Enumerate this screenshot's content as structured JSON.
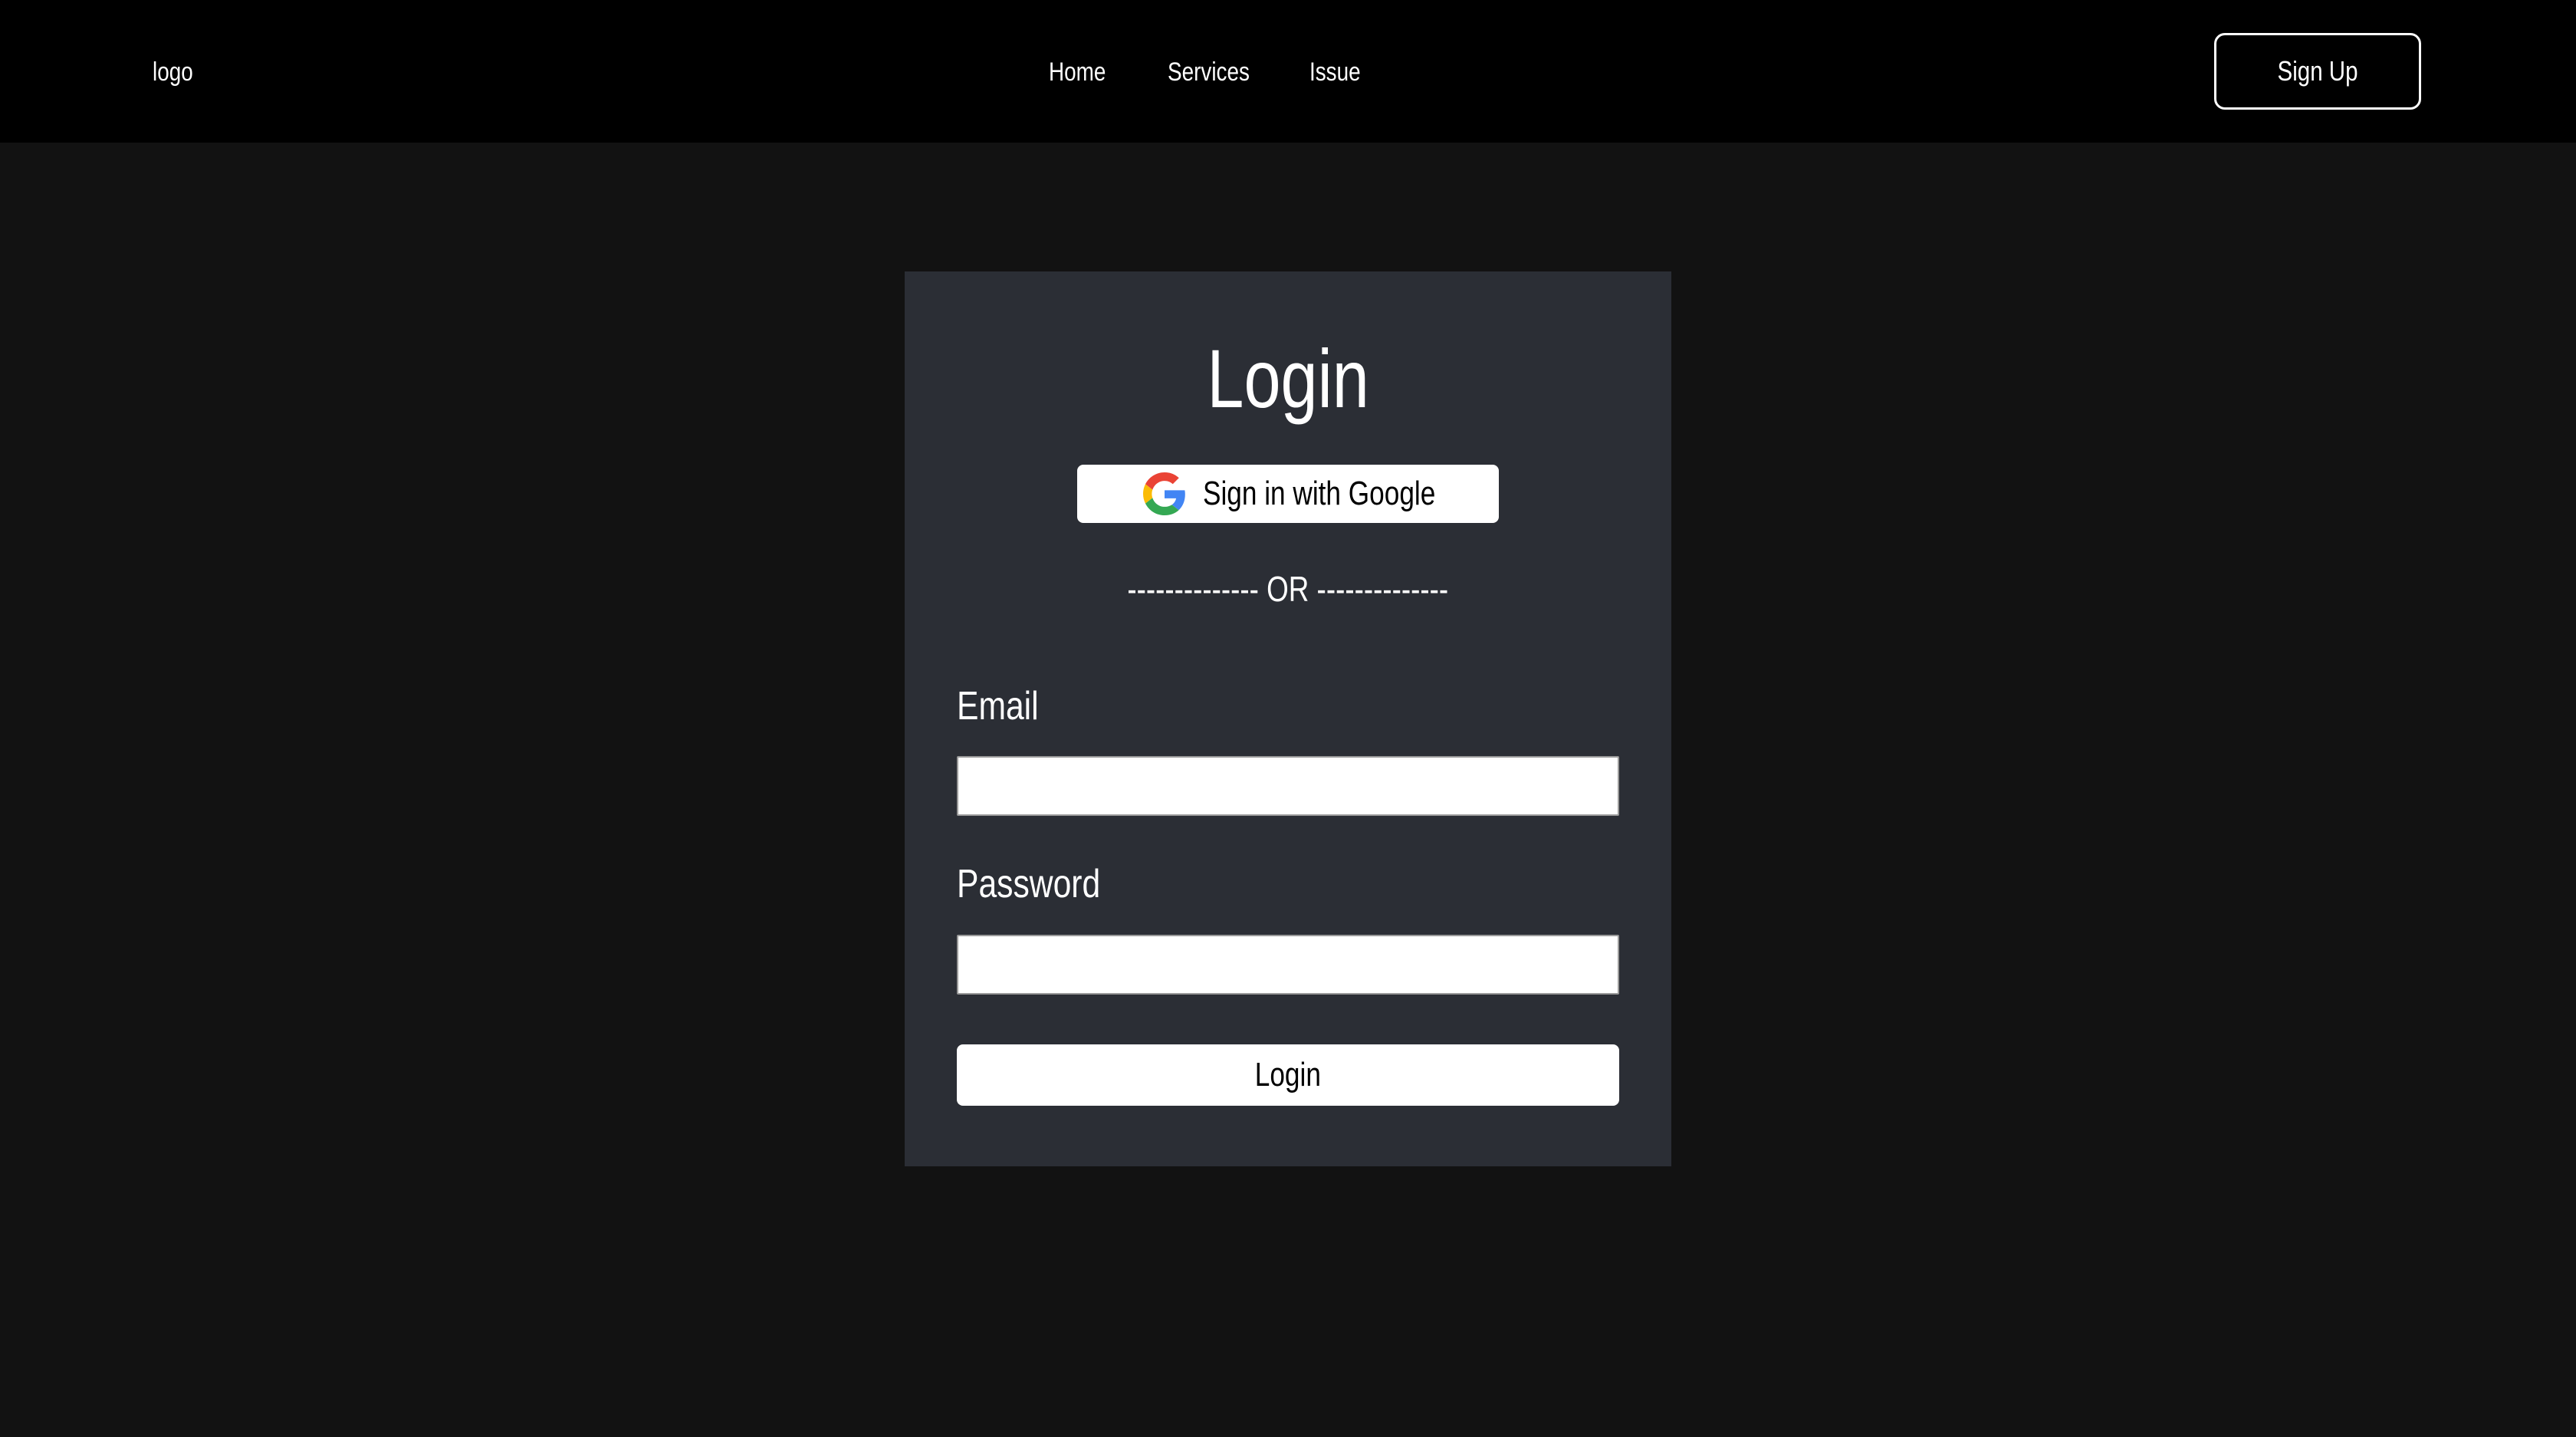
{
  "navbar": {
    "logo": "logo",
    "links": [
      "Home",
      "Services",
      "Issue"
    ],
    "signup_label": "Sign Up"
  },
  "login_card": {
    "title": "Login",
    "google_button_label": "Sign in with Google",
    "google_icon": "google-g-icon",
    "divider_text": "-------------- OR --------------",
    "email_label": "Email",
    "email_value": "",
    "password_label": "Password",
    "password_value": "",
    "submit_label": "Login"
  },
  "colors": {
    "page_background": "#121212",
    "navbar_background": "#000000",
    "card_background": "#2b2e35",
    "text": "#ffffff"
  }
}
